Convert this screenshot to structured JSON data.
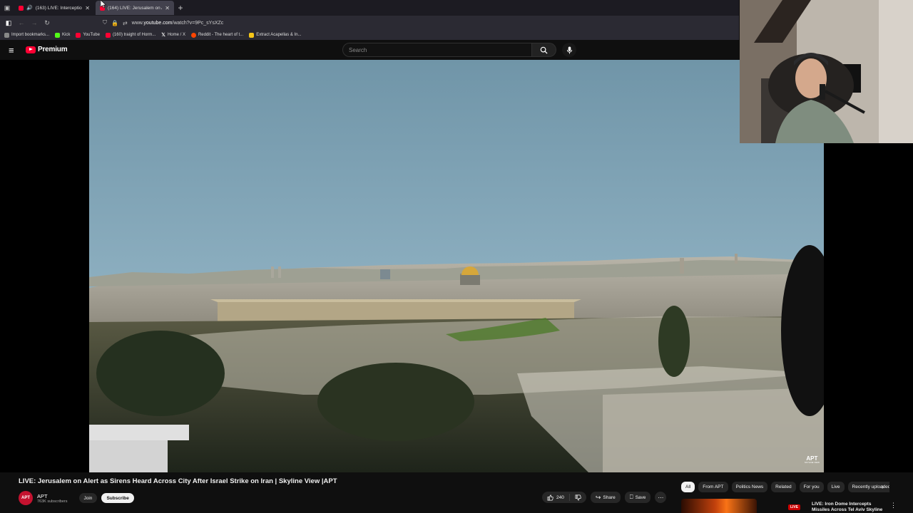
{
  "browser": {
    "tabs": [
      {
        "title": "(163) LIVE: Interceptions in",
        "active": false,
        "audio": true
      },
      {
        "title": "(164) LIVE: Jerusalem on Alert",
        "active": true,
        "audio": false
      }
    ],
    "url_prefix": "www.",
    "url_domain": "youtube.com",
    "url_path": "/watch?v=9Pc_sYsXZc",
    "bookmarks": [
      {
        "label": "Import bookmarks...",
        "color": "#888888"
      },
      {
        "label": "Kick",
        "color": "#53fc18"
      },
      {
        "label": "YouTube",
        "color": "#ff0033"
      },
      {
        "label": "(160) traight of Horm...",
        "color": "#ff0033"
      },
      {
        "label": "Home / X",
        "color": "#000000"
      },
      {
        "label": "Reddit - The heart of t...",
        "color": "#ff4500"
      },
      {
        "label": "Extract Acapellas & In...",
        "color": "#f5c518"
      }
    ]
  },
  "youtube": {
    "brand": "Premium",
    "search_placeholder": "Search",
    "channel_bug": "APT",
    "channel_bug_sub": "SKYLINE VIEW"
  },
  "video": {
    "title": "LIVE: Jerusalem on Alert as Sirens Heard Across City After Israel Strike on Iran | Skyline View |APT",
    "channel_name": "APT",
    "avatar_text": "APT",
    "subscribers": "763K subscribers",
    "join_label": "Join",
    "subscribe_label": "Subscribe",
    "likes": "240",
    "share_label": "Share",
    "save_label": "Save"
  },
  "chips": [
    "All",
    "From APT",
    "Politics News",
    "Related",
    "For you",
    "Live",
    "Recently uploaded"
  ],
  "recommendation": {
    "badge": "LIVE",
    "title": "LIVE: Iron Dome Intercepts Missiles Across Tel Aviv Skyline"
  },
  "colors": {
    "accent": "#ff0033",
    "background": "#0f0f0f",
    "chip_active": "#f1f1f1"
  }
}
